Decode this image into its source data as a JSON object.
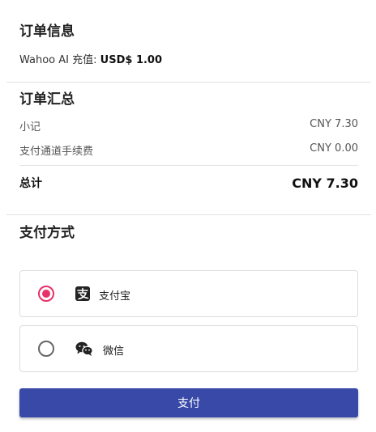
{
  "order_info": {
    "title": "订单信息",
    "product": "Wahoo AI 充值:",
    "amount": "USD$ 1.00"
  },
  "order_summary": {
    "title": "订单汇总",
    "rows": [
      {
        "label": "小记",
        "value": "CNY 7.30"
      },
      {
        "label": "支付通道手续费",
        "value": "CNY 0.00"
      }
    ],
    "total": {
      "label": "总计",
      "value": "CNY 7.30"
    }
  },
  "payment": {
    "title": "支付方式",
    "methods": [
      {
        "label": "支付宝",
        "icon": "alipay-icon",
        "selected": true
      },
      {
        "label": "微信",
        "icon": "wechat-icon",
        "selected": false
      }
    ],
    "submit_label": "支付"
  },
  "colors": {
    "accent": "#e8316a",
    "button": "#3849a8"
  }
}
